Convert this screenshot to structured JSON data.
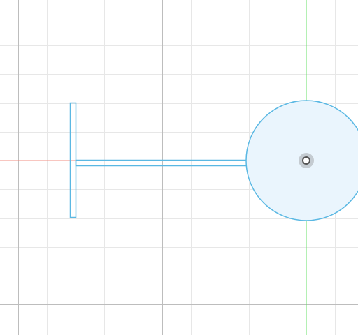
{
  "canvas": {
    "background_color": "#ffffff",
    "minor_grid_color": "#e7e7e7",
    "major_grid_color": "#bdbdbd",
    "x_axis_color": "#f08c80",
    "y_axis_color": "#68e068",
    "sketch_stroke_color": "#5ab8e3",
    "sketch_fill_color": "#eaf5fd",
    "origin_marker_color": "#7d7d7d"
  },
  "sketch": {
    "shapes": [
      "vertical-bar",
      "horizontal-bar",
      "circle"
    ],
    "origin_marker_icon": "origin-point-icon"
  }
}
